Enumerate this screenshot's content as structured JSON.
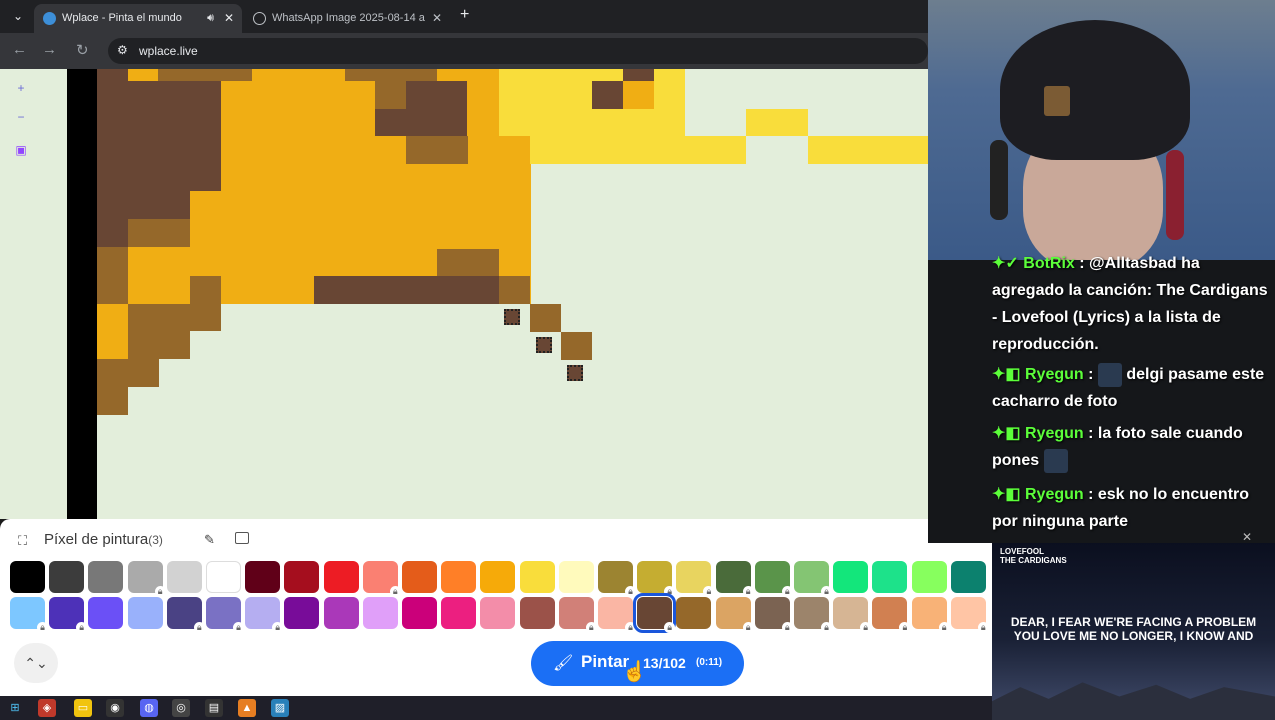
{
  "browser": {
    "tabs": [
      {
        "title": "Wplace - Pinta el mundo",
        "active": true
      },
      {
        "title": "WhatsApp Image 2025-08-14 a",
        "active": false
      }
    ],
    "url": "wplace.live"
  },
  "canvas": {
    "background": "#e3eedb"
  },
  "panel": {
    "title": "Píxel de pintura",
    "count": "(3)",
    "paint_label": "Pintar",
    "paint_count": "13/102",
    "paint_timer": "(0:11)",
    "collapse_icon": "chevrons-icon"
  },
  "palette": {
    "row1": [
      {
        "color": "#000000",
        "locked": false
      },
      {
        "color": "#3c3c3c",
        "locked": false
      },
      {
        "color": "#787878",
        "locked": false
      },
      {
        "color": "#aaaaaa",
        "locked": true
      },
      {
        "color": "#d2d2d2",
        "locked": false
      },
      {
        "color": "#ffffff",
        "locked": false
      },
      {
        "color": "#600018",
        "locked": false
      },
      {
        "color": "#a50e1e",
        "locked": false
      },
      {
        "color": "#ed1c24",
        "locked": false
      },
      {
        "color": "#fa8072",
        "locked": true
      },
      {
        "color": "#e45c1a",
        "locked": false
      },
      {
        "color": "#ff7f27",
        "locked": false
      },
      {
        "color": "#f6aa09",
        "locked": false
      },
      {
        "color": "#f9dd3b",
        "locked": false
      },
      {
        "color": "#fffabc",
        "locked": false
      },
      {
        "color": "#9c8431",
        "locked": true
      },
      {
        "color": "#c5ad31",
        "locked": true
      },
      {
        "color": "#e8d45f",
        "locked": true
      },
      {
        "color": "#4a6b3a",
        "locked": true
      },
      {
        "color": "#5a944a",
        "locked": true
      },
      {
        "color": "#84c573",
        "locked": true
      },
      {
        "color": "#13e67b",
        "locked": false
      },
      {
        "color": "#1de28a",
        "locked": false
      },
      {
        "color": "#87ff5e",
        "locked": false
      },
      {
        "color": "#0c816e",
        "locked": false
      }
    ],
    "row2": [
      {
        "color": "#7dc7ff",
        "locked": true
      },
      {
        "color": "#4d31b8",
        "locked": true
      },
      {
        "color": "#6b50f6",
        "locked": false
      },
      {
        "color": "#99b1fb",
        "locked": false
      },
      {
        "color": "#4a4284",
        "locked": true
      },
      {
        "color": "#7a71c4",
        "locked": true
      },
      {
        "color": "#b5aef1",
        "locked": true
      },
      {
        "color": "#780c99",
        "locked": false
      },
      {
        "color": "#aa38b9",
        "locked": false
      },
      {
        "color": "#e09ff9",
        "locked": false
      },
      {
        "color": "#cb007a",
        "locked": false
      },
      {
        "color": "#ec1f80",
        "locked": false
      },
      {
        "color": "#f38da9",
        "locked": false
      },
      {
        "color": "#9b5249",
        "locked": false
      },
      {
        "color": "#d18078",
        "locked": true
      },
      {
        "color": "#fab6a4",
        "locked": true
      },
      {
        "color": "#684634",
        "locked": true,
        "selected": true
      },
      {
        "color": "#95682a",
        "locked": false
      },
      {
        "color": "#dba463",
        "locked": true
      },
      {
        "color": "#7b6352",
        "locked": true
      },
      {
        "color": "#9c846b",
        "locked": true
      },
      {
        "color": "#d6b594",
        "locked": true
      },
      {
        "color": "#d18051",
        "locked": true
      },
      {
        "color": "#f8b277",
        "locked": true
      },
      {
        "color": "#ffc5a5",
        "locked": true
      }
    ]
  },
  "chat": {
    "messages": [
      {
        "user": "BotRix",
        "text": "@Alltasbad ha agregado la canción: The Cardigans - Lovefool (Lyrics) a la lista de reproducción."
      },
      {
        "user": "Ryegun",
        "text": "delgi pasame este cacharro de foto"
      },
      {
        "user": "Ryegun",
        "text": "la foto sale cuando pones"
      },
      {
        "user": "Ryegun",
        "text": "esk no lo encuentro por ninguna parte"
      }
    ]
  },
  "music_video": {
    "logo_line1": "LOVEFOOL",
    "logo_line2": "THE CARDIGANS",
    "lyric_line1": "DEAR, I FEAR WE'RE FACING A PROBLEM",
    "lyric_line2": "YOU LOVE ME NO LONGER, I KNOW AND"
  }
}
